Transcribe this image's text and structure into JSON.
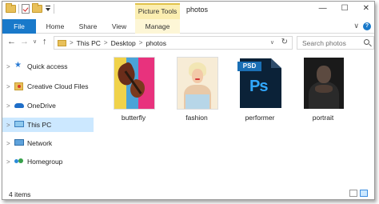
{
  "window": {
    "title": "photos",
    "context_tab": "Picture Tools",
    "buttons": {
      "minimize": "—",
      "maximize": "☐",
      "close": "✕"
    }
  },
  "ribbon": {
    "tabs": [
      "File",
      "Home",
      "Share",
      "View",
      "Manage"
    ],
    "help": "?",
    "collapse": "∨"
  },
  "nav": {
    "back": "←",
    "forward": "→",
    "recent": "∨",
    "up": "↑",
    "breadcrumb": [
      "This PC",
      "Desktop",
      "photos"
    ],
    "breadcrumb_separator": ">",
    "dropdown": "∨",
    "refresh": "↻"
  },
  "search": {
    "placeholder": "Search photos"
  },
  "sidebar": {
    "items": [
      {
        "label": "Quick access",
        "icon": "star-icon"
      },
      {
        "label": "Creative Cloud Files",
        "icon": "creative-cloud-folder-icon"
      },
      {
        "label": "OneDrive",
        "icon": "onedrive-icon"
      },
      {
        "label": "This PC",
        "icon": "computer-icon",
        "selected": true
      },
      {
        "label": "Network",
        "icon": "network-icon"
      },
      {
        "label": "Homegroup",
        "icon": "homegroup-icon"
      }
    ],
    "expand_arrow": ">"
  },
  "files": [
    {
      "name": "butterfly",
      "type": "image"
    },
    {
      "name": "fashion",
      "type": "image"
    },
    {
      "name": "performer",
      "type": "psd",
      "tag": "PSD",
      "badge": "Ps"
    },
    {
      "name": "portrait",
      "type": "image"
    }
  ],
  "status": {
    "item_count": "4 items"
  },
  "colors": {
    "accent": "#1979ca",
    "selection": "#cce8ff",
    "manage_tab": "#fbeeb0",
    "photoshop": "#31a8ff"
  }
}
